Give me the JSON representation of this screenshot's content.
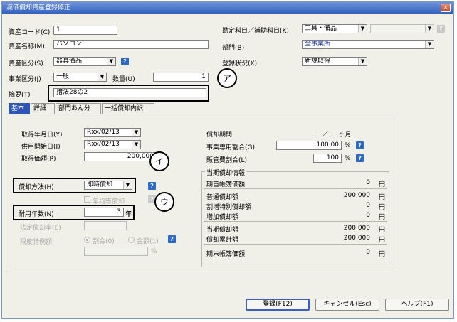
{
  "window": {
    "title": "減価償却資産登録修正",
    "close": "×"
  },
  "header": {
    "asset_code_label": "資産コード(C)",
    "asset_code_value": "1",
    "asset_name_label": "資産名称(M)",
    "asset_name_value": "パソコン",
    "asset_class_label": "資産区分(S)",
    "asset_class_value": "器具備品",
    "business_class_label": "事業区分(J)",
    "business_class_value": "一般",
    "quantity_label": "数量(U)",
    "quantity_value": "1",
    "summary_label": "摘要(T)",
    "summary_value": "措法28の2",
    "account_label": "勘定科目／補助科目(K)",
    "account_value": "工具・備品",
    "subaccount_value": "",
    "dept_label": "部門(B)",
    "dept_value": "全事業所",
    "reg_status_label": "登録状況(X)",
    "reg_status_value": "新規取得"
  },
  "tabs": [
    "基本",
    "詳細",
    "部門あん分",
    "一括償却内訳"
  ],
  "left": {
    "acq_date_label": "取得年月日(Y)",
    "acq_date_value": "Rxx/02/13",
    "start_date_label": "供用開始日(I)",
    "start_date_value": "Rxx/02/13",
    "acq_price_label": "取得価額(P)",
    "acq_price_value": "200,000",
    "method_label": "償却方法(H)",
    "method_value": "即時償却",
    "installment_label": "年均等償却",
    "life_label": "耐用年数(N)",
    "life_value": "3",
    "life_unit": "年",
    "rate_label": "法定償却率(E)",
    "limit_label": "限度特例額",
    "ratio_option": "割合(0)",
    "amount_option": "金額(1)",
    "percent": "%"
  },
  "right": {
    "period_label": "償却期間",
    "period_value": "－ ／ － ヶ月",
    "biz_ratio_label": "事業専用割合(G)",
    "biz_ratio_value": "100.00",
    "biz_ratio_unit": "%",
    "sales_ratio_label": "販管費割合(L)",
    "sales_ratio_value": "100",
    "sales_ratio_unit": "%",
    "current_title": "当期償却情報",
    "rows": [
      {
        "label": "期首帳簿価額",
        "value": "0",
        "unit": "円"
      },
      {
        "label": "普通償却額",
        "value": "200,000",
        "unit": "円"
      },
      {
        "label": "割増特別償却額",
        "value": "0",
        "unit": "円"
      },
      {
        "label": "増加償却額",
        "value": "0",
        "unit": "円"
      },
      {
        "label": "当期償却額",
        "value": "200,000",
        "unit": "円"
      },
      {
        "label": "償却累計額",
        "value": "200,000",
        "unit": "円"
      },
      {
        "label": "期末帳簿価額",
        "value": "0",
        "unit": "円"
      }
    ]
  },
  "callouts": {
    "a": "ア",
    "i": "イ",
    "u": "ウ"
  },
  "buttons": {
    "register": "登録(F12)",
    "cancel": "キャンセル(Esc)",
    "help": "ヘルプ(F1)"
  },
  "help_mark": "?"
}
